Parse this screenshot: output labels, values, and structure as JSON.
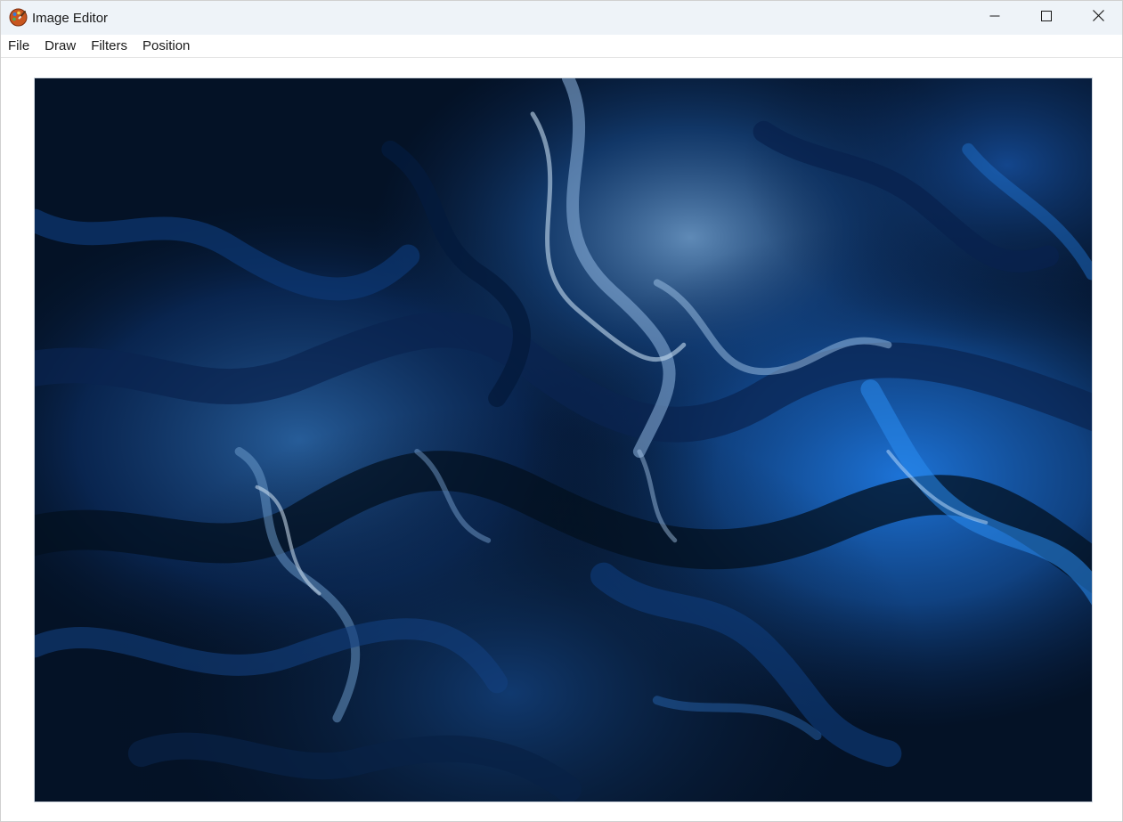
{
  "window": {
    "title": "Image Editor",
    "app_icon": "palette-icon",
    "controls": {
      "minimize_icon": "minimize-icon",
      "maximize_icon": "maximize-icon",
      "close_icon": "close-icon"
    }
  },
  "menu": {
    "items": [
      {
        "label": "File"
      },
      {
        "label": "Draw"
      },
      {
        "label": "Filters"
      },
      {
        "label": "Position"
      }
    ]
  },
  "canvas": {
    "image_subject": "abstract dark blue fluid marble art",
    "colors": {
      "background": "#020812",
      "deep_blue": "#0a2a5c",
      "mid_blue": "#1556a8",
      "bright_blue": "#1e78e0",
      "highlight": "#9fc4e8"
    }
  }
}
